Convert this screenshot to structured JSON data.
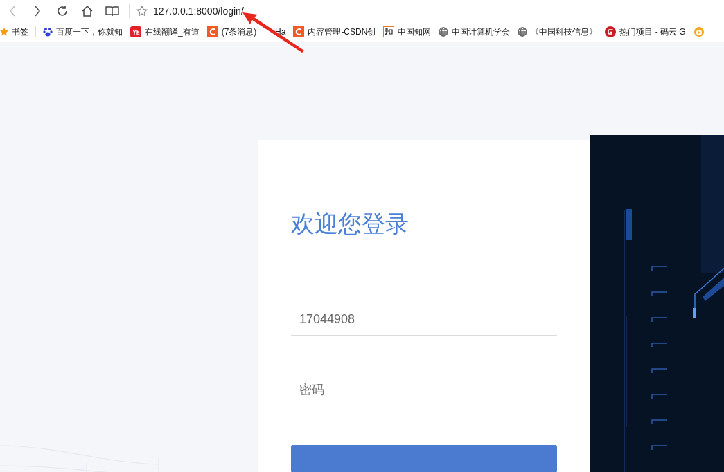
{
  "browser": {
    "address": "127.0.0.1:8000/login/",
    "bookmarks": [
      {
        "label": "书签",
        "kind": "star"
      },
      {
        "label": "百度一下，你就知",
        "kind": "paw"
      },
      {
        "label": "在线翻译_有道",
        "kind": "youdao"
      },
      {
        "label": "(7条消息)        Ha",
        "kind": "csdn"
      },
      {
        "label": "内容管理-CSDN创",
        "kind": "csdn"
      },
      {
        "label": "中国知网",
        "kind": "cnki"
      },
      {
        "label": "中国计算机学会",
        "kind": "globe"
      },
      {
        "label": "《中国科技信息》",
        "kind": "globe"
      },
      {
        "label": "热门项目 - 码云 G",
        "kind": "gitee"
      },
      {
        "kind": "mascot"
      }
    ]
  },
  "login": {
    "title": "欢迎您登录",
    "username": {
      "value": "17044908"
    },
    "password": {
      "placeholder": "密码"
    }
  }
}
